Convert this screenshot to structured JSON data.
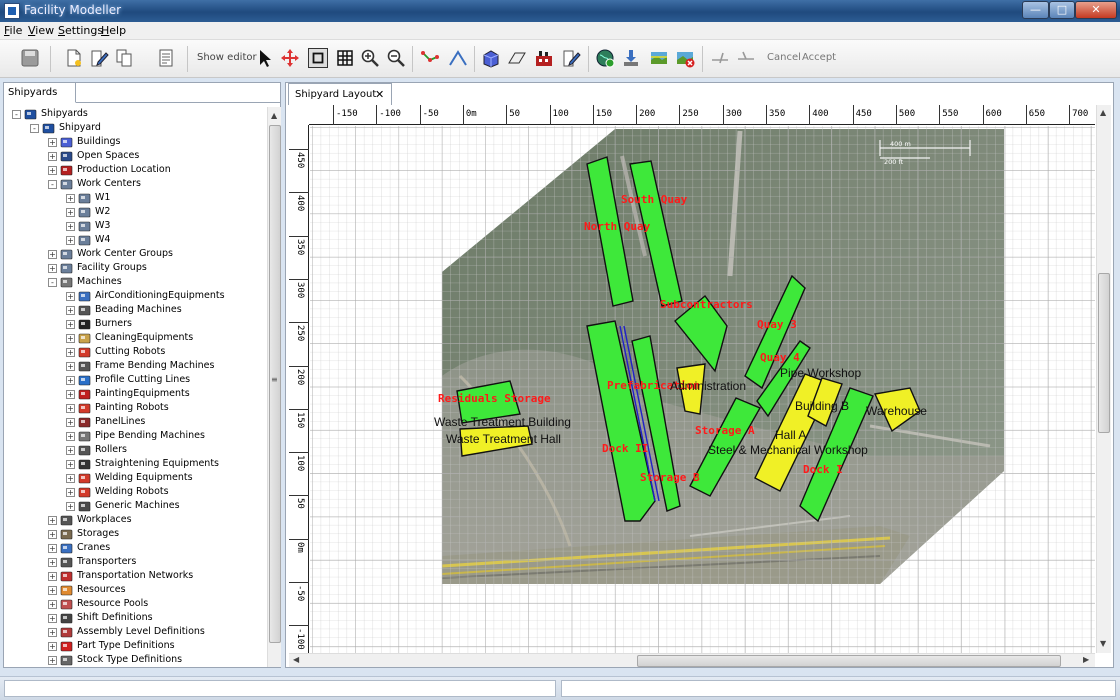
{
  "window": {
    "title": "Facility Modeller"
  },
  "menu": [
    {
      "text": "File",
      "mnemonic": "F",
      "rest": "ile"
    },
    {
      "text": "View",
      "mnemonic": "V",
      "rest": "iew"
    },
    {
      "text": "Settings",
      "mnemonic": "S",
      "rest": "ettings"
    },
    {
      "text": "Help",
      "mnemonic": "H",
      "rest": "elp"
    }
  ],
  "toolbar": {
    "show_editor": "Show editor",
    "cancel": "Cancel",
    "accept": "Accept"
  },
  "left_panel": {
    "tab": "Shipyards",
    "tree": [
      {
        "label": "Shipyards",
        "icon": "shipyard-icon",
        "level": 0,
        "expander": "-"
      },
      {
        "label": "Shipyard",
        "icon": "shipyard-icon",
        "level": 1,
        "expander": "-"
      },
      {
        "label": "Buildings",
        "icon": "building-icon",
        "level": 2,
        "expander": "+"
      },
      {
        "label": "Open Spaces",
        "icon": "open-space-icon",
        "level": 2,
        "expander": "+"
      },
      {
        "label": "Production Location",
        "icon": "factory-icon",
        "level": 2,
        "expander": "+"
      },
      {
        "label": "Work Centers",
        "icon": "work-center-icon",
        "level": 2,
        "expander": "-"
      },
      {
        "label": "W1",
        "icon": "work-center-icon",
        "level": 3,
        "expander": "+"
      },
      {
        "label": "W2",
        "icon": "work-center-icon",
        "level": 3,
        "expander": "+"
      },
      {
        "label": "W3",
        "icon": "work-center-icon",
        "level": 3,
        "expander": "+"
      },
      {
        "label": "W4",
        "icon": "work-center-icon",
        "level": 3,
        "expander": "+"
      },
      {
        "label": "Work Center Groups",
        "icon": "work-center-icon",
        "level": 2,
        "expander": "+"
      },
      {
        "label": "Facility Groups",
        "icon": "work-center-icon",
        "level": 2,
        "expander": "+"
      },
      {
        "label": "Machines",
        "icon": "gear-icon",
        "level": 2,
        "expander": "-"
      },
      {
        "label": "AirConditioningEquipments",
        "icon": "fan-icon",
        "level": 3,
        "expander": "+"
      },
      {
        "label": "Beading Machines",
        "icon": "gears-icon",
        "level": 3,
        "expander": "+"
      },
      {
        "label": "Burners",
        "icon": "burner-icon",
        "level": 3,
        "expander": "+"
      },
      {
        "label": "CleaningEquipments",
        "icon": "brush-icon",
        "level": 3,
        "expander": "+"
      },
      {
        "label": "Cutting Robots",
        "icon": "robot-arm-icon",
        "level": 3,
        "expander": "+"
      },
      {
        "label": "Frame Bending Machines",
        "icon": "gears-icon",
        "level": 3,
        "expander": "+"
      },
      {
        "label": "Profile Cutting Lines",
        "icon": "profile-icon",
        "level": 3,
        "expander": "+"
      },
      {
        "label": "PaintingEquipments",
        "icon": "paint-icon",
        "level": 3,
        "expander": "+"
      },
      {
        "label": "Painting Robots",
        "icon": "robot-arm-icon",
        "level": 3,
        "expander": "+"
      },
      {
        "label": "PanelLines",
        "icon": "panel-icon",
        "level": 3,
        "expander": "+"
      },
      {
        "label": "Pipe Bending Machines",
        "icon": "pipe-icon",
        "level": 3,
        "expander": "+"
      },
      {
        "label": "Rollers",
        "icon": "gears-icon",
        "level": 3,
        "expander": "+"
      },
      {
        "label": "Straightening Equipments",
        "icon": "press-icon",
        "level": 3,
        "expander": "+"
      },
      {
        "label": "Welding Equipments",
        "icon": "robot-arm-icon",
        "level": 3,
        "expander": "+"
      },
      {
        "label": "Welding Robots",
        "icon": "robot-arm-icon",
        "level": 3,
        "expander": "+"
      },
      {
        "label": "Generic Machines",
        "icon": "generic-machine-icon",
        "level": 3,
        "expander": "+"
      },
      {
        "label": "Workplaces",
        "icon": "gears-icon",
        "level": 2,
        "expander": "+"
      },
      {
        "label": "Storages",
        "icon": "storage-icon",
        "level": 2,
        "expander": "+"
      },
      {
        "label": "Cranes",
        "icon": "crane-icon",
        "level": 2,
        "expander": "+"
      },
      {
        "label": "Transporters",
        "icon": "gears-icon",
        "level": 2,
        "expander": "+"
      },
      {
        "label": "Transportation Networks",
        "icon": "network-icon",
        "level": 2,
        "expander": "+"
      },
      {
        "label": "Resources",
        "icon": "person-icon",
        "level": 2,
        "expander": "+"
      },
      {
        "label": "Resource Pools",
        "icon": "people-icon",
        "level": 2,
        "expander": "+"
      },
      {
        "label": "Shift Definitions",
        "icon": "clock-icon",
        "level": 2,
        "expander": "+"
      },
      {
        "label": "Assembly Level Definitions",
        "icon": "assembly-icon",
        "level": 2,
        "expander": "+"
      },
      {
        "label": "Part Type Definitions",
        "icon": "part-icon",
        "level": 2,
        "expander": "+"
      },
      {
        "label": "Stock Type Definitions",
        "icon": "stock-icon",
        "level": 2,
        "expander": "+"
      }
    ]
  },
  "editor": {
    "tab": "Shipyard Layout",
    "ruler_x": [
      "-150",
      "-100",
      "-50",
      "0m",
      "50",
      "100",
      "150",
      "200",
      "250",
      "300",
      "350",
      "400",
      "450",
      "500",
      "550",
      "600",
      "650",
      "700"
    ],
    "ruler_y": [
      "450",
      "400",
      "350",
      "300",
      "250",
      "200",
      "150",
      "100",
      "50",
      "0m",
      "-50",
      "-100"
    ],
    "scale_legend": [
      "400 m",
      "200 ft"
    ],
    "areas": [
      {
        "name": "South Quay",
        "color": "green"
      },
      {
        "name": "North Quay",
        "color": "green"
      },
      {
        "name": "Subcontractors",
        "color": "green"
      },
      {
        "name": "Quay 3",
        "color": "green"
      },
      {
        "name": "Quay 4",
        "color": "green"
      },
      {
        "name": "Prefabrication",
        "color": "green"
      },
      {
        "name": "Administration",
        "color": "yellow"
      },
      {
        "name": "Residuals Storage",
        "color": "green"
      },
      {
        "name": "Waste Treatment Building",
        "color": "yellow"
      },
      {
        "name": "Waste Treatment Hall",
        "color": "yellow"
      },
      {
        "name": "Dock II",
        "color": "green"
      },
      {
        "name": "Storage B",
        "color": "green"
      },
      {
        "name": "Storage A",
        "color": "green"
      },
      {
        "name": "Pipe Workshop",
        "color": "yellow"
      },
      {
        "name": "Building B",
        "color": "yellow"
      },
      {
        "name": "Warehouse",
        "color": "yellow"
      },
      {
        "name": "Hall A",
        "color": "yellow"
      },
      {
        "name": "Steel & Mechanical Workshop",
        "color": "yellow"
      },
      {
        "name": "Dock I",
        "color": "green"
      }
    ],
    "colors": {
      "green": "#3ee83a",
      "yellow": "#f0f026",
      "label_red": "#ff1a1a"
    }
  }
}
